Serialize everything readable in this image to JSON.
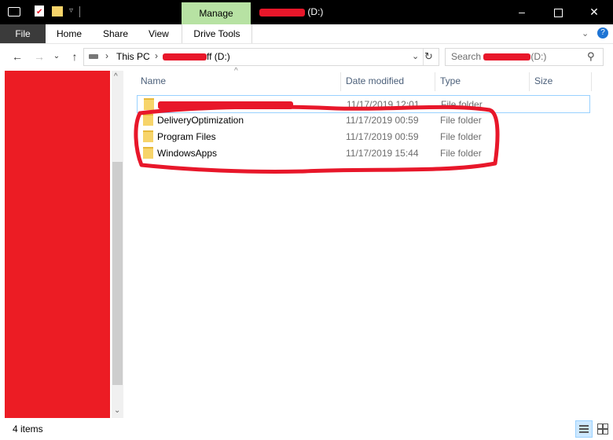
{
  "titlebar": {
    "manage_tab": "Manage",
    "title_suffix": "(D:)"
  },
  "ribbon": {
    "tabs": [
      "File",
      "Home",
      "Share",
      "View"
    ],
    "drive_tools": "Drive Tools"
  },
  "address": {
    "this_pc": "This PC",
    "suffix": "ff (D:)"
  },
  "search": {
    "prefix": "Search",
    "suffix": "(D:)"
  },
  "columns": {
    "name": "Name",
    "date": "Date modified",
    "type": "Type",
    "size": "Size"
  },
  "rows": [
    {
      "name": "",
      "date": "11/17/2019 12:01",
      "type": "File folder",
      "redacted": true
    },
    {
      "name": "DeliveryOptimization",
      "date": "11/17/2019 00:59",
      "type": "File folder"
    },
    {
      "name": "Program Files",
      "date": "11/17/2019 00:59",
      "type": "File folder"
    },
    {
      "name": "WindowsApps",
      "date": "11/17/2019 15:44",
      "type": "File folder"
    }
  ],
  "status": {
    "items": "4 items"
  },
  "colors": {
    "redaction": "#e8172a",
    "manage_tab": "#b7e2a3",
    "file_tab": "#3b3b3b"
  }
}
